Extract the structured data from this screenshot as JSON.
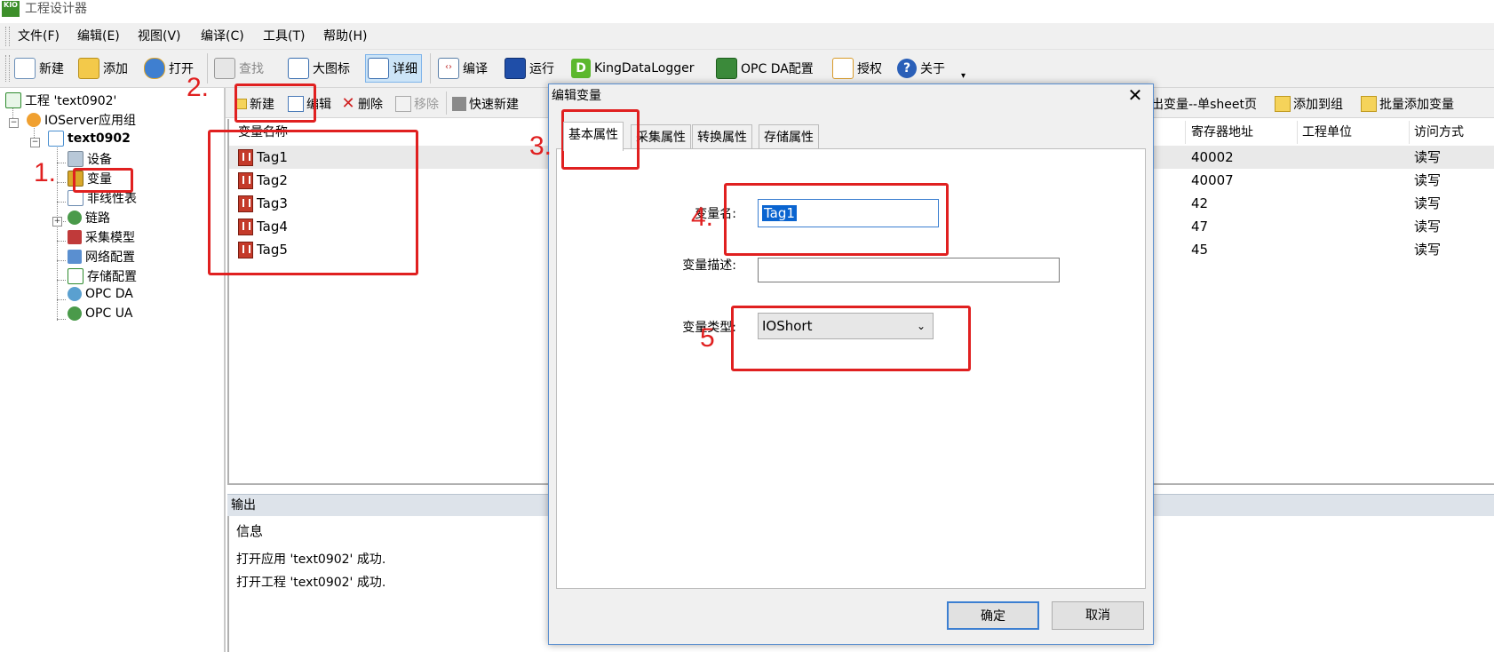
{
  "window": {
    "title": "工程设计器",
    "logo_text": "KIO"
  },
  "menu": [
    "文件(F)",
    "编辑(E)",
    "视图(V)",
    "编译(C)",
    "工具(T)",
    "帮助(H)"
  ],
  "toolbar": {
    "new": "新建",
    "add": "添加",
    "open": "打开",
    "find": "查找",
    "large_icons": "大图标",
    "details": "详细",
    "compile": "编译",
    "run": "运行",
    "kingdatalogger": "KingDataLogger",
    "opcda_config": "OPC DA配置",
    "license": "授权",
    "about": "关于"
  },
  "tree": {
    "root": "工程 'text0902'",
    "group": "IOServer应用组",
    "app": "text0902",
    "items": [
      "设备",
      "变量",
      "非线性表",
      "链路",
      "采集模型",
      "网络配置",
      "存储配置",
      "OPC DA",
      "OPC UA"
    ]
  },
  "var_toolbar": {
    "new": "新建",
    "edit": "编辑",
    "delete": "删除",
    "remove": "移除",
    "quick_new": "快速新建",
    "export_sheet": "出变量--单sheet页",
    "add_to_group": "添加到组",
    "batch_add": "批量添加变量"
  },
  "var_table": {
    "headers": {
      "name": "变量名称",
      "register": "寄存器地址",
      "unit": "工程单位",
      "access": "访问方式"
    },
    "rows": [
      {
        "name": "Tag1",
        "register": "40002",
        "access": "读写"
      },
      {
        "name": "Tag2",
        "register": "40007",
        "access": "读写"
      },
      {
        "name": "Tag3",
        "register": "42",
        "access": "读写"
      },
      {
        "name": "Tag4",
        "register": "47",
        "access": "读写"
      },
      {
        "name": "Tag5",
        "register": "45",
        "access": "读写"
      }
    ]
  },
  "output": {
    "header": "输出",
    "column": "信息",
    "lines": [
      "打开应用 'text0902' 成功.",
      "打开工程 'text0902' 成功."
    ]
  },
  "dialog": {
    "title": "编辑变量",
    "close": "✕",
    "tabs": [
      "基本属性",
      "采集属性",
      "转换属性",
      "存储属性"
    ],
    "fields": {
      "name_label": "变量名:",
      "name_value": "Tag1",
      "desc_label": "变量描述:",
      "desc_value": "",
      "type_label": "变量类型:",
      "type_value": "IOShort"
    },
    "ok": "确定",
    "cancel": "取消"
  },
  "annotations": [
    "1.",
    "2.",
    "3.",
    "4.",
    "5"
  ],
  "colors": {
    "annotation": "#e02020",
    "selection": "#0a64d0",
    "dialog_border": "#5a8fd0"
  }
}
